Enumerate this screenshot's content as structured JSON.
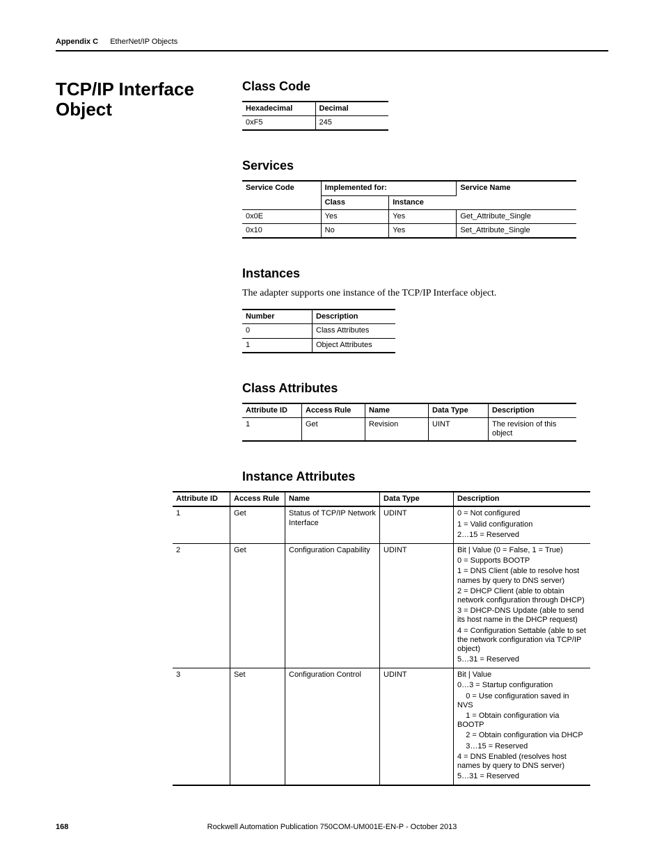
{
  "header": {
    "appendix": "Appendix C",
    "title": "EtherNet/IP Objects"
  },
  "section_title": "TCP/IP Interface Object",
  "class_code": {
    "heading": "Class Code",
    "columns": [
      "Hexadecimal",
      "Decimal"
    ],
    "row": [
      "0xF5",
      "245"
    ]
  },
  "services": {
    "heading": "Services",
    "col_service_code": "Service Code",
    "col_impl": "Implemented for:",
    "col_class": "Class",
    "col_instance": "Instance",
    "col_name": "Service Name",
    "rows": [
      {
        "code": "0x0E",
        "cls": "Yes",
        "inst": "Yes",
        "name": "Get_Attribute_Single"
      },
      {
        "code": "0x10",
        "cls": "No",
        "inst": "Yes",
        "name": "Set_Attribute_Single"
      }
    ]
  },
  "instances": {
    "heading": "Instances",
    "intro": "The adapter supports one instance of the TCP/IP Interface object.",
    "columns": [
      "Number",
      "Description"
    ],
    "rows": [
      {
        "num": "0",
        "desc": "Class Attributes"
      },
      {
        "num": "1",
        "desc": "Object Attributes"
      }
    ]
  },
  "class_attributes": {
    "heading": "Class Attributes",
    "columns": [
      "Attribute ID",
      "Access Rule",
      "Name",
      "Data Type",
      "Description"
    ],
    "rows": [
      {
        "id": "1",
        "rule": "Get",
        "name": "Revision",
        "dtype": "UINT",
        "desc": "The revision of this object"
      }
    ]
  },
  "instance_attributes": {
    "heading": "Instance Attributes",
    "columns": [
      "Attribute ID",
      "Access Rule",
      "Name",
      "Data Type",
      "Description"
    ],
    "rows": [
      {
        "id": "1",
        "rule": "Get",
        "name": "Status of TCP/IP Network Interface",
        "dtype": "UDINT",
        "desc_lines": [
          "0 = Not configured",
          "1 = Valid configuration",
          "2…15 = Reserved"
        ]
      },
      {
        "id": "2",
        "rule": "Get",
        "name": "Configuration Capability",
        "dtype": "UDINT",
        "desc_lines": [
          "Bit | Value (0 = False, 1 = True)",
          "0 = Supports BOOTP",
          "1 = DNS Client (able to resolve host names by query to DNS server)",
          "2 = DHCP Client (able to obtain network configuration through DHCP)",
          "3 = DHCP-DNS Update (able to send its host name in the DHCP request)",
          "4 = Configuration Settable (able to set the network configuration via TCP/IP object)",
          "5…31 = Reserved"
        ]
      },
      {
        "id": "3",
        "rule": "Set",
        "name": "Configuration Control",
        "dtype": "UDINT",
        "desc_lines": [
          "Bit | Value",
          "0…3 = Startup configuration",
          "    0 = Use configuration saved in NVS",
          "    1 = Obtain configuration via BOOTP",
          "    2 = Obtain configuration via DHCP",
          "    3…15 = Reserved",
          "4 = DNS Enabled (resolves host names by query to DNS server)",
          "5…31 = Reserved"
        ]
      }
    ]
  },
  "footer": {
    "page": "168",
    "pub": "Rockwell Automation Publication 750COM-UM001E-EN-P - October 2013"
  }
}
